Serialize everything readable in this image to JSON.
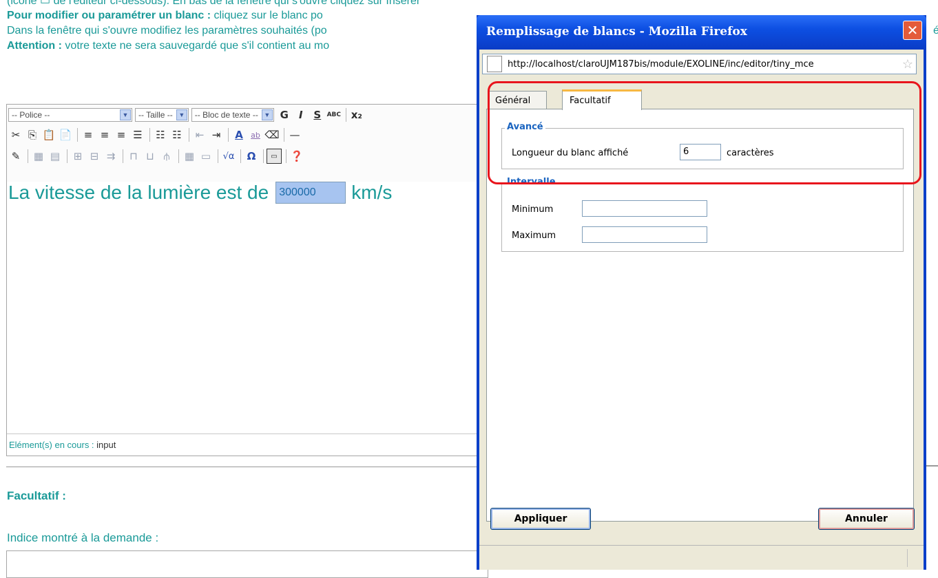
{
  "page": {
    "instructions_cut": "(icône ▭ de l'éditeur ci-dessous). En bas de la fenêtre qui s'ouvre cliquez sur Insérer",
    "line1_bold": "Pour modifier ou paramétrer un blanc :",
    "line1_text": " cliquez sur le blanc po",
    "line2_text": "Dans la fenêtre qui s'ouvre modifiez les paramètres souhaités (po",
    "line3_bold": "Attention :",
    "line3_text": " votre texte ne sera sauvegardé que s'il contient au mo",
    "right_sliver": "é",
    "toolbar": {
      "font_select": "-- Police --",
      "size_select": "-- Taille --",
      "block_select": "-- Bloc de texte --"
    },
    "editor": {
      "content_text": "La vitesse de la lumière est de",
      "blank_value": "300000",
      "unit_text": "km/s"
    },
    "status_label": "Elément(s) en cours : ",
    "status_value": "input",
    "facultatif_title": "Facultatif :",
    "hint_label": "Indice montré à la demande :"
  },
  "popup": {
    "title": "Remplissage de blancs - Mozilla Firefox",
    "close_glyph": "✕",
    "url": "http://localhost/claroUJM187bis/module/EXOLINE/inc/editor/tiny_mce",
    "tabs": [
      {
        "label": "Général",
        "active": false
      },
      {
        "label": "Facultatif",
        "active": true
      }
    ],
    "advanced": {
      "legend": "Avancé",
      "length_label": "Longueur du blanc affiché",
      "length_value": "6",
      "length_unit": "caractères"
    },
    "interval": {
      "legend": "Intervalle",
      "min_label": "Minimum",
      "min_value": "",
      "max_label": "Maximum",
      "max_value": ""
    },
    "apply_label": "Appliquer",
    "cancel_label": "Annuler"
  },
  "colors": {
    "accent_text": "#1a9a98",
    "titlebar": "#0a3fc9",
    "highlight": "#e8141c",
    "active_tab": "#f7b842"
  }
}
